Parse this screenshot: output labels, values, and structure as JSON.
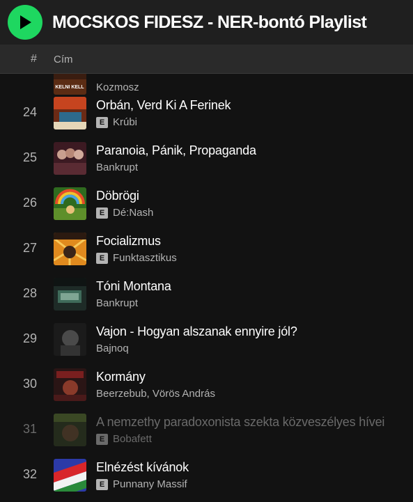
{
  "playlist": {
    "title": "MOCSKOS FIDESZ - NER-bontó Playlist",
    "accent_color": "#1ed760",
    "play_icon": "play-icon"
  },
  "columns": {
    "number": "#",
    "title": "Cím"
  },
  "partial_row": {
    "artist": "Kozmosz",
    "cover_text": "KELNI KELL"
  },
  "tracks": [
    {
      "number": "24",
      "title": "Orbán, Verd Ki A Ferinek",
      "artist": "Krúbi",
      "explicit": true,
      "disabled": false
    },
    {
      "number": "25",
      "title": "Paranoia, Pánik, Propaganda",
      "artist": "Bankrupt",
      "explicit": false,
      "disabled": false
    },
    {
      "number": "26",
      "title": "Döbrögi",
      "artist": "Dé:Nash",
      "explicit": true,
      "disabled": false
    },
    {
      "number": "27",
      "title": "Focializmus",
      "artist": "Funktasztikus",
      "explicit": true,
      "disabled": false
    },
    {
      "number": "28",
      "title": "Tóni Montana",
      "artist": "Bankrupt",
      "explicit": false,
      "disabled": false
    },
    {
      "number": "29",
      "title": "Vajon - Hogyan alszanak ennyire jól?",
      "artist": "Bajnoq",
      "explicit": false,
      "disabled": false
    },
    {
      "number": "30",
      "title": "Kormány",
      "artist": "Beerzebub, Vörös András",
      "explicit": false,
      "disabled": false
    },
    {
      "number": "31",
      "title": "A nemzethy paradoxonista szekta közveszélyes hívei",
      "artist": "Bobafett",
      "explicit": true,
      "disabled": true
    },
    {
      "number": "32",
      "title": "Elnézést kívánok",
      "artist": "Punnany Massif",
      "explicit": true,
      "disabled": false
    }
  ],
  "explicit_label": "E"
}
